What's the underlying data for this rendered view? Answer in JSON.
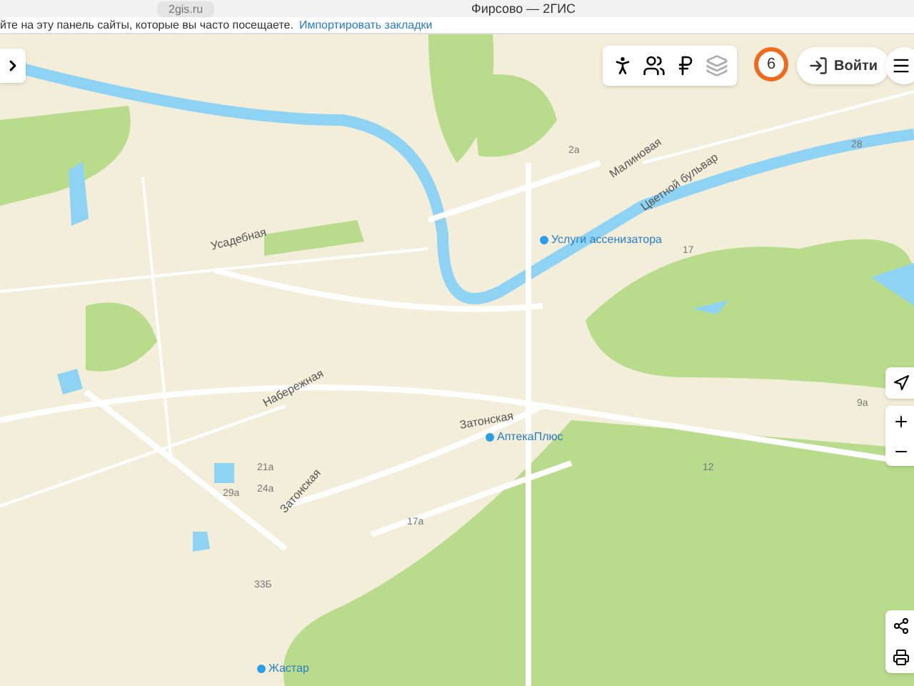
{
  "browser": {
    "address": "2gis.ru",
    "title": "Фирсово — 2ГИС"
  },
  "bookmarks_bar": {
    "text": "йте на эту панель сайты, которые вы часто посещаете.",
    "link": "Импортировать закладки"
  },
  "map": {
    "labels": [
      {
        "text": "Усадебная",
        "kind": "street"
      },
      {
        "text": "Набережная",
        "kind": "street"
      },
      {
        "text": "Затонская",
        "kind": "street"
      },
      {
        "text": "Затонская",
        "kind": "street"
      },
      {
        "text": "Малиновая",
        "kind": "street"
      },
      {
        "text": "Цветной бульвар",
        "kind": "street"
      },
      {
        "text": "Услуги ассенизатора",
        "kind": "poi"
      },
      {
        "text": "АптекаПлюс",
        "kind": "poi"
      },
      {
        "text": "Жастар",
        "kind": "poi"
      },
      {
        "text": "24а",
        "kind": "house"
      },
      {
        "text": "29а",
        "kind": "house"
      },
      {
        "text": "21а",
        "kind": "house"
      },
      {
        "text": "17а",
        "kind": "house"
      },
      {
        "text": "33Б",
        "kind": "house"
      },
      {
        "text": "12",
        "kind": "house"
      },
      {
        "text": "17",
        "kind": "house"
      },
      {
        "text": "28",
        "kind": "house"
      },
      {
        "text": "2а",
        "kind": "house"
      },
      {
        "text": "9а",
        "kind": "house"
      }
    ]
  },
  "toolbar": {
    "badge": "6",
    "login": "Войти"
  }
}
